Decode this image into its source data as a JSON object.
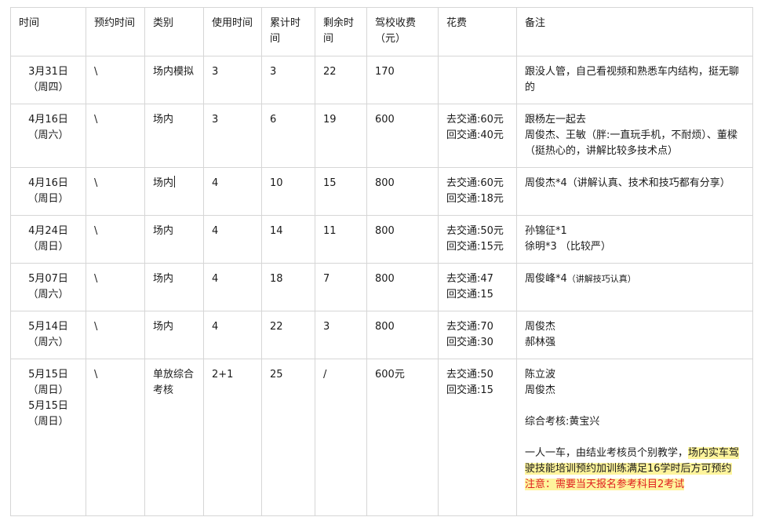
{
  "headers": [
    "时间",
    "预约时间",
    "类别",
    "使用时间",
    "累计时间",
    "剩余时间",
    "驾校收费（元）",
    "花费",
    "备注"
  ],
  "rows": [
    {
      "date": [
        "3月31日",
        "（周四）"
      ],
      "booking": "\\",
      "category": "场内模拟",
      "use": "3",
      "total": "3",
      "remain": "22",
      "fee": "170",
      "cost": [],
      "notes": [
        "跟没人管，自己看视频和熟悉车内结构，挺无聊的"
      ]
    },
    {
      "date": [
        "4月16日",
        "（周六）"
      ],
      "booking": "\\",
      "category": "场内",
      "use": "3",
      "total": "6",
      "remain": "19",
      "fee": "600",
      "cost": [
        "去交通:60元",
        "回交通:40元"
      ],
      "notes": [
        "跟杨左一起去",
        "周俊杰、王敏（胖:一直玩手机，不耐烦）、董樑（挺热心的，讲解比较多技术点）"
      ]
    },
    {
      "date": [
        "4月16日",
        "（周日）"
      ],
      "booking": "\\",
      "category": "场内",
      "use": "4",
      "total": "10",
      "remain": "15",
      "fee": "800",
      "cost": [
        "去交通:60元",
        "回交通:18元"
      ],
      "notes": [
        "周俊杰*4（讲解认真、技术和技巧都有分享）"
      ]
    },
    {
      "date": [
        "4月24日",
        "（周日）"
      ],
      "booking": "\\",
      "category": "场内",
      "use": "4",
      "total": "14",
      "remain": "11",
      "fee": "800",
      "cost": [
        "去交通:50元",
        "回交通:15元"
      ],
      "notes": [
        "孙锦征*1",
        "徐明*3 （比较严）"
      ]
    },
    {
      "date": [
        "5月07日",
        "（周六）"
      ],
      "booking": "\\",
      "category": "场内",
      "use": "4",
      "total": "18",
      "remain": "7",
      "fee": "800",
      "cost": [
        "去交通:47",
        "回交通:15"
      ],
      "notes": [
        "周俊峰*4"
      ],
      "note_small": "（讲解技巧认真）"
    },
    {
      "date": [
        "5月14日",
        "（周六）"
      ],
      "booking": "\\",
      "category": "场内",
      "use": "4",
      "total": "22",
      "remain": "3",
      "fee": "800",
      "cost": [
        "去交通:70",
        "回交通:30"
      ],
      "notes": [
        "周俊杰",
        "郝林强"
      ]
    },
    {
      "date": [
        "5月15日",
        "（周日）",
        "5月15日",
        "（周日）"
      ],
      "booking": "\\",
      "category": "单放综合考核",
      "use": "2+1",
      "total": "25",
      "remain": "/",
      "fee": "600元",
      "cost": [
        "去交通:50",
        "回交通:15"
      ],
      "notes": [
        "陈立波",
        "周俊杰"
      ],
      "exam": "综合考核:黄宝兴",
      "desc_plain": "一人一车，由结业考核员个别教学，",
      "desc_highlight": "场内实车驾驶技能培训预约加训练满足16学时后方可预约",
      "warning": "注意：需要当天报名参考科目2考试"
    }
  ]
}
